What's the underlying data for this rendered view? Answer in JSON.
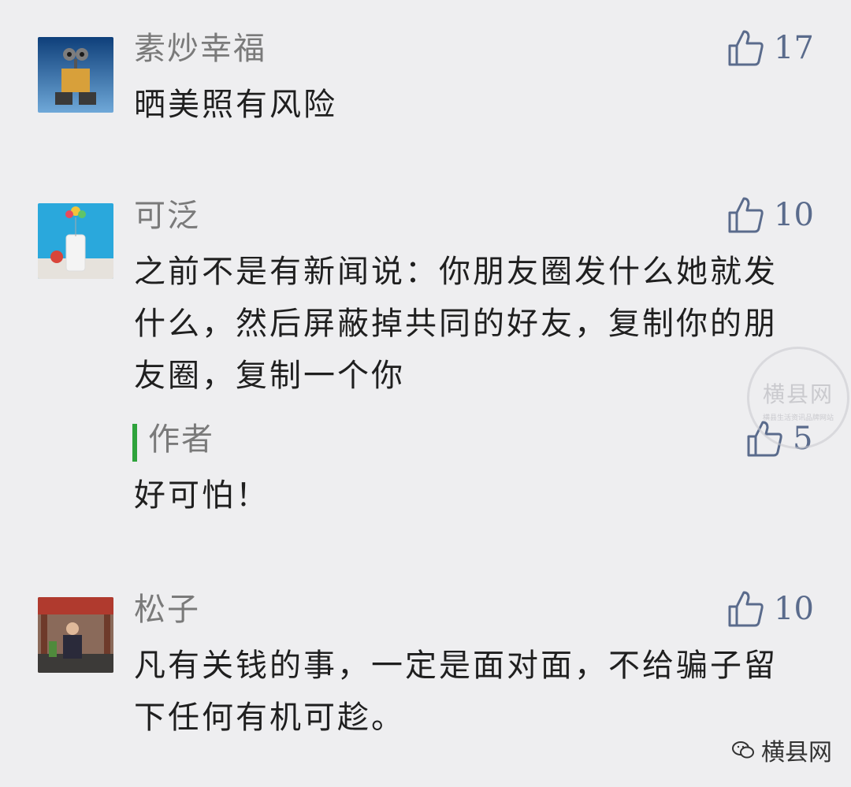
{
  "comments": [
    {
      "name": "素炒幸福",
      "text": "晒美照有风险",
      "likes": "17"
    },
    {
      "name": "可泛",
      "text": "之前不是有新闻说：你朋友圈发什么她就发什么，然后屏蔽掉共同的好友，复制你的朋友圈，复制一个你",
      "reply": {
        "name": "作者",
        "text": "好可怕！",
        "likes": "5"
      },
      "likes": "10"
    },
    {
      "name": "松子",
      "text": "凡有关钱的事，一定是面对面，不给骗子留下任何有机可趁。",
      "likes": "10"
    }
  ],
  "watermark": {
    "big": "横县网",
    "small": "横县生活资讯品牌网站"
  },
  "footer": {
    "brand": "横县网"
  },
  "colors": {
    "background": "#eeeef0",
    "like": "#5a6b8c",
    "reply_bar": "#2ea33c"
  }
}
